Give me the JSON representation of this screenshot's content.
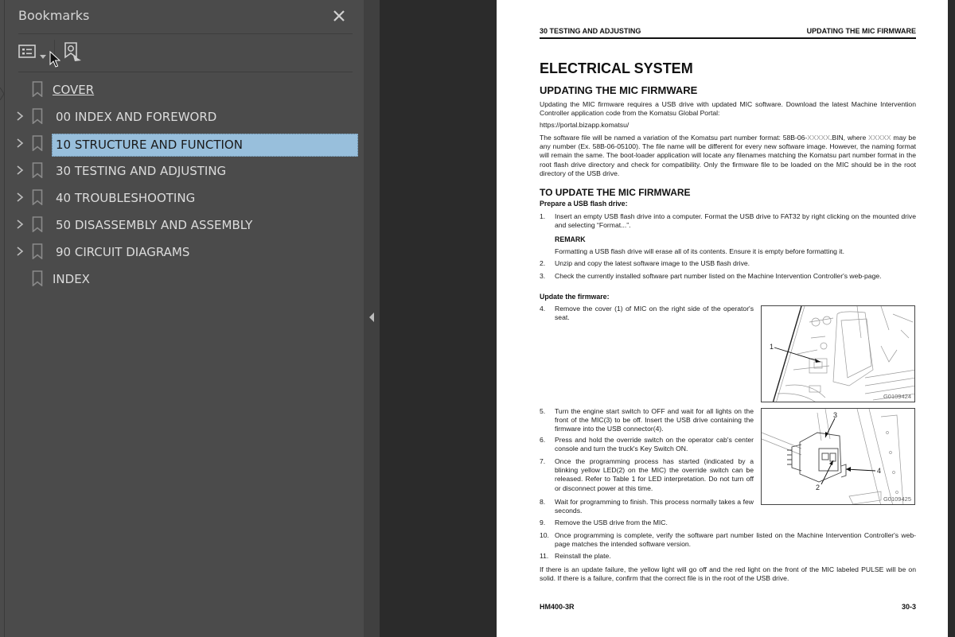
{
  "bookmarks_panel": {
    "title": "Bookmarks",
    "close_icon": "close-x",
    "toolbar": {
      "options_icon": "list-options-icon",
      "options_dropdown_icon": "caret-down",
      "find_bookmark_icon": "bookmark-search-icon"
    },
    "items": [
      {
        "label": "COVER",
        "expandable": false,
        "selected": false,
        "underlined": true
      },
      {
        "label": "00 INDEX AND FOREWORD",
        "expandable": true,
        "selected": false,
        "underlined": false
      },
      {
        "label": "10 STRUCTURE AND FUNCTION",
        "expandable": true,
        "selected": true,
        "underlined": false
      },
      {
        "label": "30 TESTING AND ADJUSTING",
        "expandable": true,
        "selected": false,
        "underlined": false
      },
      {
        "label": "40 TROUBLESHOOTING",
        "expandable": true,
        "selected": false,
        "underlined": false
      },
      {
        "label": "50 DISASSEMBLY AND ASSEMBLY",
        "expandable": true,
        "selected": false,
        "underlined": false
      },
      {
        "label": "90 CIRCUIT DIAGRAMS",
        "expandable": true,
        "selected": false,
        "underlined": false
      },
      {
        "label": "INDEX",
        "expandable": false,
        "selected": false,
        "underlined": false
      }
    ],
    "colors": {
      "panel_bg": "#4b4b4b",
      "selected_bg": "#98bfdc",
      "text": "#dcdcdc"
    }
  },
  "collapse_handle": {
    "icon": "triangle-left"
  },
  "document": {
    "header_left": "30 TESTING AND ADJUSTING",
    "header_right": "UPDATING THE MIC FIRMWARE",
    "title": "ELECTRICAL SYSTEM",
    "section1_title": "UPDATING THE MIC FIRMWARE",
    "intro": "Updating the MIC firmware requires a USB drive with updated MIC software. Download the latest Machine Intervention Controller application code from the Komatsu Global Portal:",
    "url": "https://portal.bizapp.komatsu/",
    "naming_p1": "The software file will be named a variation of the Komatsu part number format: 58B-06-",
    "naming_x1": "XXXXX",
    "naming_p2": ".BIN, where ",
    "naming_x2": "XXXXX",
    "naming_p3": " may be any number (Ex. 58B-06-05100). The file name will be different for every new software image. However, the naming format will remain the same. The boot-loader application will locate any filenames matching the Komatsu part number format in the root flash drive directory and check for compatibility. Only the firmware file to be loaded on the MIC should be in the root directory of the USB drive.",
    "section2_title": "TO UPDATE THE MIC FIRMWARE",
    "prepare_heading": "Prepare a USB flash drive:",
    "steps_prepare": [
      {
        "n": "1.",
        "text": "Insert an empty USB flash drive into a computer. Format the USB drive to FAT32 by right clicking on the mounted drive and selecting “Format...”."
      },
      {
        "n": "2.",
        "text": "Unzip and copy the latest software image to the USB flash drive."
      },
      {
        "n": "3.",
        "text": "Check the currently installed software part number listed on the Machine Intervention Controller's web-page."
      }
    ],
    "remark_heading": "REMARK",
    "remark_text": "Formatting a USB flash drive will erase all of its contents. Ensure it is empty before formatting it.",
    "update_heading": "Update the firmware:",
    "steps_update": [
      {
        "n": "4.",
        "text": "Remove the cover (1) of MIC on the right side of the operator's seat."
      },
      {
        "n": "5.",
        "text": "Turn the engine start switch to OFF and wait for all lights on the front of the MIC(3) to be off. Insert the USB drive containing the firmware into the USB connector(4)."
      },
      {
        "n": "6.",
        "text": "Press and hold the override switch on the operator cab's center console and turn the truck's Key Switch ON."
      },
      {
        "n": "7.",
        "text": "Once the programming process has started (indicated by a blinking yellow LED(2) on the MIC) the override switch can be released. Refer to Table 1 for LED interpretation. Do not turn off or disconnect power at this time."
      },
      {
        "n": "8.",
        "text": "Wait for programming to finish. This process normally takes a few seconds."
      },
      {
        "n": "9.",
        "text": "Remove the USB drive from the MIC."
      },
      {
        "n": "10.",
        "text": "Once programming is complete, verify the software part number listed on the Machine Intervention Controller's web-page matches the intended software version."
      },
      {
        "n": "11.",
        "text": "Reinstall the plate."
      }
    ],
    "failure_note": "If there is an update failure, the yellow light will go off and the red light on the front of the MIC labeled PULSE will be on solid. If there is a failure, confirm that the correct file is in the root of the USB drive.",
    "figures": [
      {
        "caption": "G0109424",
        "callouts": [
          "1"
        ]
      },
      {
        "caption": "G0109425",
        "callouts": [
          "3",
          "2",
          "4"
        ]
      }
    ],
    "footer_left": "HM400-3R",
    "footer_right": "30-3"
  }
}
